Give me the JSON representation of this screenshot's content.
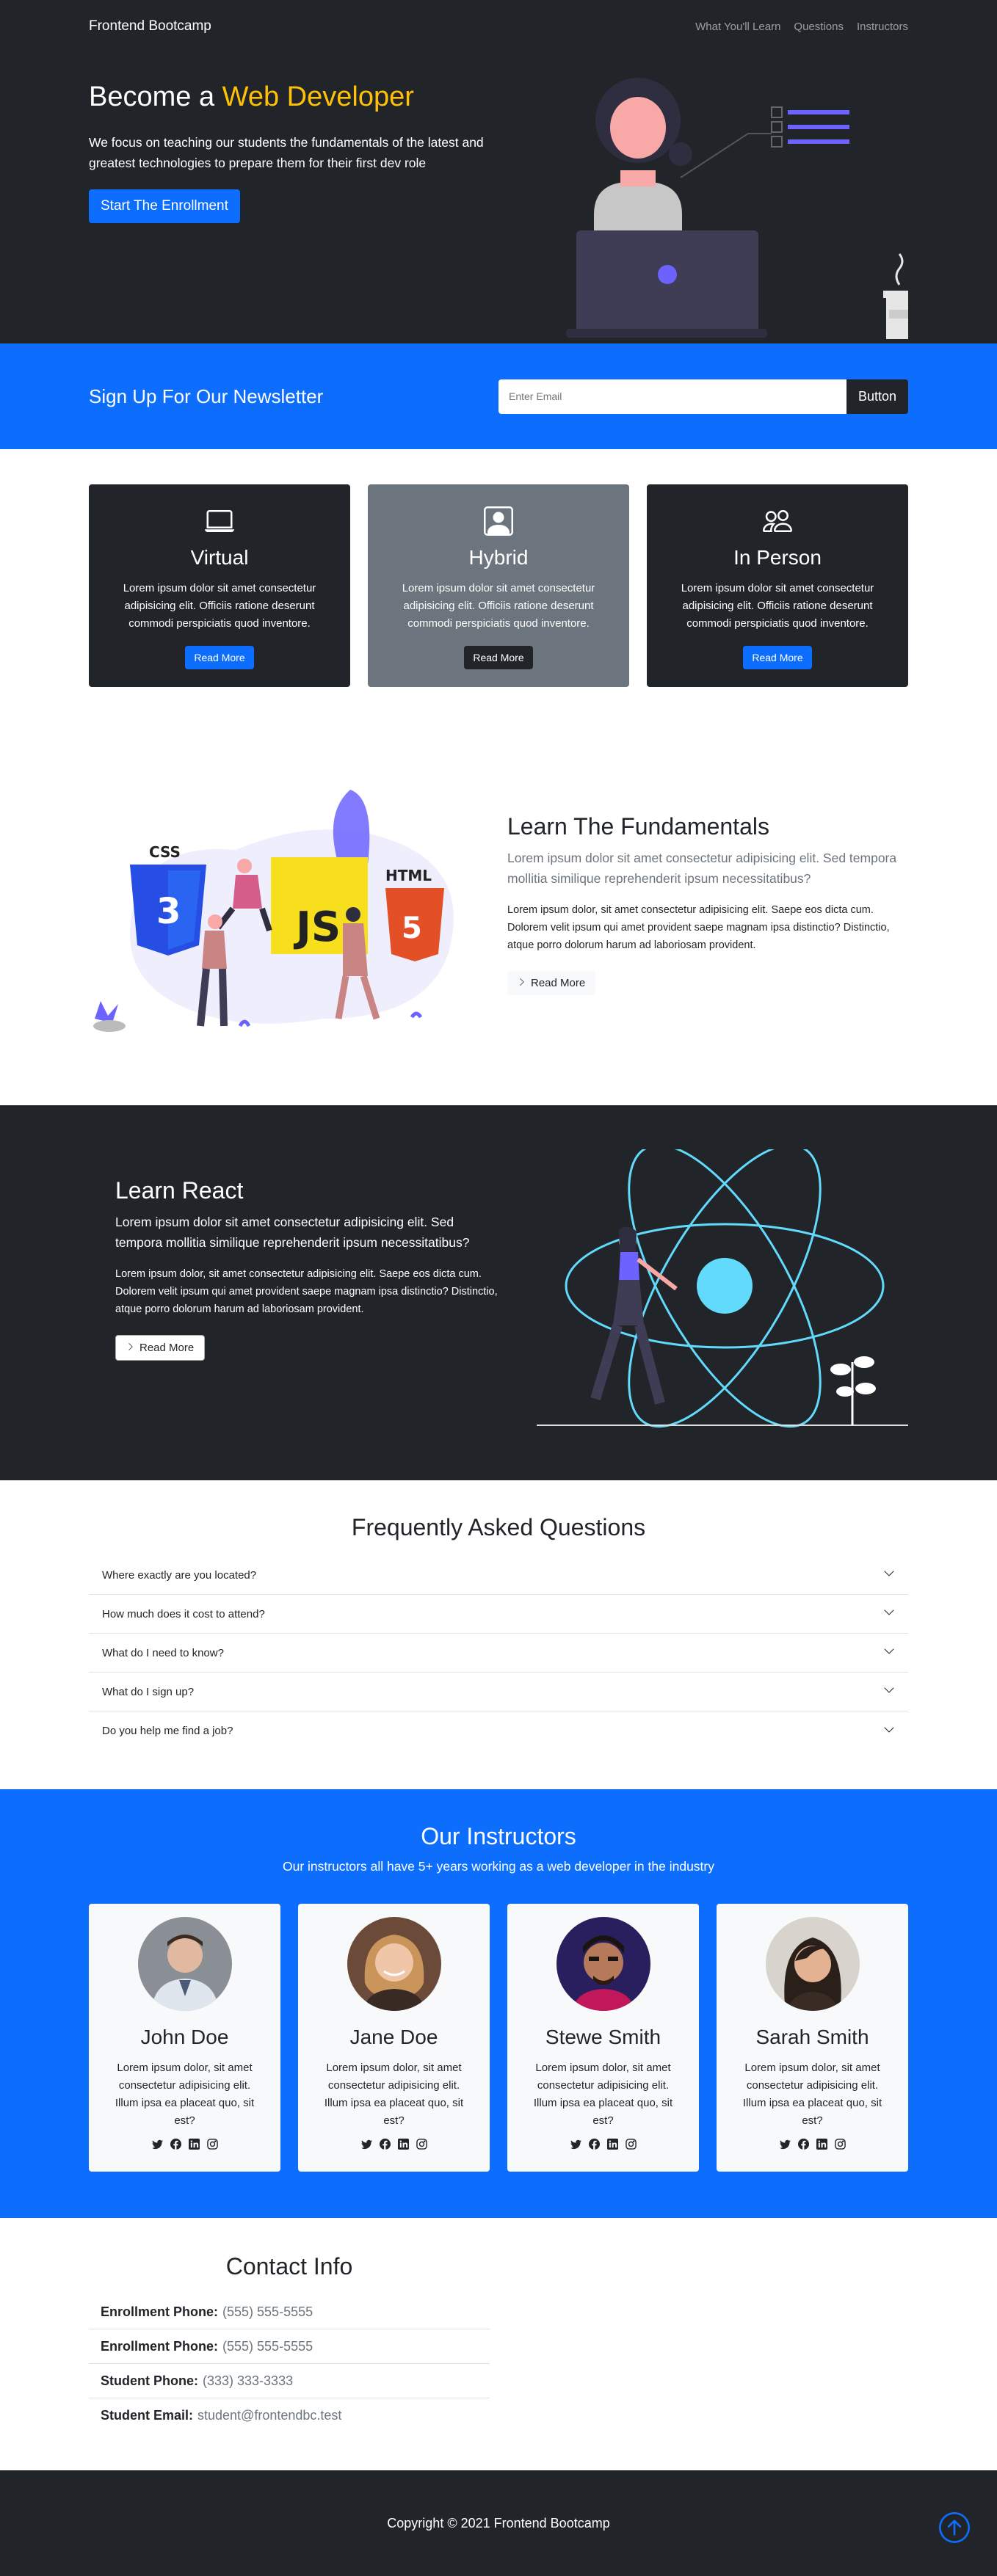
{
  "nav": {
    "brand": "Frontend Bootcamp",
    "links": [
      "What You'll Learn",
      "Questions",
      "Instructors"
    ]
  },
  "hero": {
    "title_prefix": "Become a ",
    "title_accent": "Web Developer",
    "lead": "We focus on teaching our students the fundamentals of the latest and greatest technologies to prepare them for their first dev role",
    "cta": "Start The Enrollment"
  },
  "newsletter": {
    "title": "Sign Up For Our Newsletter",
    "placeholder": "Enter Email",
    "button": "Button"
  },
  "boxes": [
    {
      "icon": "laptop-icon",
      "title": "Virtual",
      "text": "Lorem ipsum dolor sit amet consectetur adipisicing elit. Officiis ratione deserunt commodi perspiciatis quod inventore.",
      "button": "Read More"
    },
    {
      "icon": "person-square-icon",
      "title": "Hybrid",
      "text": "Lorem ipsum dolor sit amet consectetur adipisicing elit. Officiis ratione deserunt commodi perspiciatis quod inventore.",
      "button": "Read More"
    },
    {
      "icon": "people-icon",
      "title": "In Person",
      "text": "Lorem ipsum dolor sit amet consectetur adipisicing elit. Officiis ratione deserunt commodi perspiciatis quod inventore.",
      "button": "Read More"
    }
  ],
  "fundamentals": {
    "img_labels": [
      "CSS",
      "JS",
      "HTML"
    ],
    "title": "Learn The Fundamentals",
    "lead": "Lorem ipsum dolor sit amet consectetur adipisicing elit. Sed tempora mollitia similique reprehenderit ipsum necessitatibus?",
    "body": "Lorem ipsum dolor, sit amet consectetur adipisicing elit. Saepe eos dicta cum. Dolorem velit ipsum qui amet provident saepe magnam ipsa distinctio? Distinctio, atque porro dolorum harum ad laboriosam provident.",
    "button": "Read More"
  },
  "react": {
    "title": "Learn React",
    "lead": "Lorem ipsum dolor sit amet consectetur adipisicing elit. Sed tempora mollitia similique reprehenderit ipsum necessitatibus?",
    "body": "Lorem ipsum dolor, sit amet consectetur adipisicing elit. Saepe eos dicta cum. Dolorem velit ipsum qui amet provident saepe magnam ipsa distinctio? Distinctio, atque porro dolorum harum ad laboriosam provident.",
    "button": "Read More"
  },
  "faq": {
    "title": "Frequently Asked Questions",
    "items": [
      "Where exactly are you located?",
      "How much does it cost to attend?",
      "What do I need to know?",
      "What do I sign up?",
      "Do you help me find a job?"
    ]
  },
  "instructors": {
    "title": "Our Instructors",
    "lead": "Our instructors all have 5+ years working as a web developer in the industry",
    "people": [
      {
        "name": "John Doe",
        "text": "Lorem ipsum dolor, sit amet consectetur adipisicing elit. Illum ipsa ea placeat quo, sit est?"
      },
      {
        "name": "Jane Doe",
        "text": "Lorem ipsum dolor, sit amet consectetur adipisicing elit. Illum ipsa ea placeat quo, sit est?"
      },
      {
        "name": "Stewe Smith",
        "text": "Lorem ipsum dolor, sit amet consectetur adipisicing elit. Illum ipsa ea placeat quo, sit est?"
      },
      {
        "name": "Sarah Smith",
        "text": "Lorem ipsum dolor, sit amet consectetur adipisicing elit. Illum ipsa ea placeat quo, sit est?"
      }
    ],
    "social_icons": [
      "twitter-icon",
      "facebook-icon",
      "linkedin-icon",
      "instagram-icon"
    ]
  },
  "contact": {
    "title": "Contact Info",
    "items": [
      {
        "label": "Enrollment Phone:",
        "value": "(555) 555-5555"
      },
      {
        "label": "Enrollment Phone:",
        "value": "(555) 555-5555"
      },
      {
        "label": "Student Phone:",
        "value": "(333) 333-3333"
      },
      {
        "label": "Student Email:",
        "value": "student@frontendbc.test"
      }
    ]
  },
  "footer": {
    "copyright": "Copyright © 2021 Frontend Bootcamp",
    "to_top_icon": "arrow-up-circle-icon"
  },
  "colors": {
    "dark": "#212529",
    "primary": "#0d6efd",
    "accent": "#ffc107",
    "gray": "#6c757d",
    "light": "#f8f9fa",
    "illustration_purple": "#6c63ff",
    "react_cyan": "#61dafb"
  }
}
